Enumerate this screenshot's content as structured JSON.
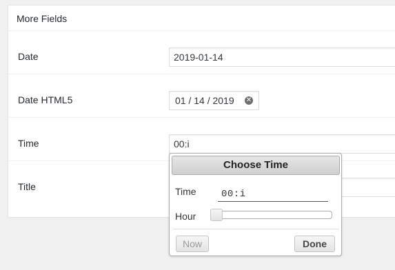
{
  "panel": {
    "title": "More Fields",
    "fields": [
      {
        "label": "Date",
        "value": "2019-01-14"
      },
      {
        "label": "Date HTML5",
        "value": "01 / 14 / 2019"
      },
      {
        "label": "Time",
        "value": "00:i"
      },
      {
        "label": "Title",
        "value": ""
      }
    ]
  },
  "time_picker": {
    "title": "Choose Time",
    "time_label": "Time",
    "time_value": "00:i",
    "hour_label": "Hour",
    "hour_slider_fraction": 0,
    "now_label": "Now",
    "done_label": "Done"
  },
  "icons": {
    "clear": "clear-icon"
  },
  "colors": {
    "background": "#f1f1f1",
    "panel": "#ffffff",
    "border": "#dddddd"
  }
}
